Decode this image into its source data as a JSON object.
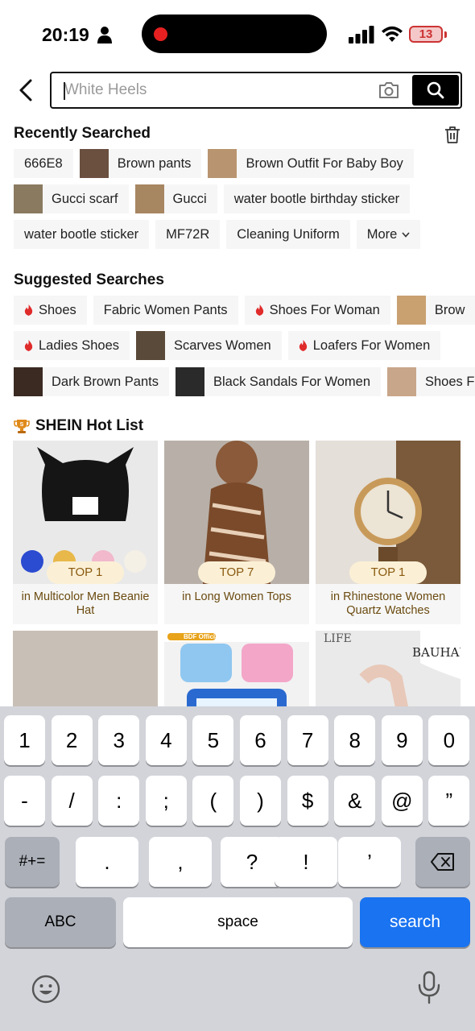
{
  "status_bar": {
    "time": "20:19",
    "battery": "13"
  },
  "search": {
    "placeholder": "White Heels"
  },
  "recent": {
    "title": "Recently Searched",
    "rows": [
      [
        {
          "label": "666E8",
          "thumb": false
        },
        {
          "label": "Brown pants",
          "thumb": true,
          "thumb_color": "#6b5040"
        },
        {
          "label": "Brown Outfit For Baby Boy",
          "thumb": true,
          "thumb_color": "#b89470"
        }
      ],
      [
        {
          "label": "Gucci scarf",
          "thumb": true,
          "thumb_color": "#8a7a60"
        },
        {
          "label": "Gucci",
          "thumb": true,
          "thumb_color": "#a78662"
        },
        {
          "label": "water bootle birthday sticker",
          "thumb": false
        }
      ],
      [
        {
          "label": "water bootle sticker",
          "thumb": false
        },
        {
          "label": "MF72R",
          "thumb": false
        },
        {
          "label": "Cleaning Uniform",
          "thumb": false
        },
        {
          "label": "More",
          "more": true
        }
      ]
    ]
  },
  "suggested": {
    "title": "Suggested Searches",
    "rows": [
      [
        {
          "label": "Shoes",
          "hot": true
        },
        {
          "label": "Fabric Women Pants"
        },
        {
          "label": "Shoes For Woman",
          "hot": true
        },
        {
          "label": "Brow",
          "thumb": true,
          "thumb_color": "#c9a070"
        }
      ],
      [
        {
          "label": "Ladies Shoes",
          "hot": true
        },
        {
          "label": "Scarves Women",
          "thumb": true,
          "thumb_color": "#5a4a3a"
        },
        {
          "label": "Loafers For Women",
          "hot": true
        }
      ],
      [
        {
          "label": "Dark Brown Pants",
          "thumb": true,
          "thumb_color": "#3a2a22"
        },
        {
          "label": "Black Sandals For Women",
          "thumb": true,
          "thumb_color": "#2a2a2a"
        },
        {
          "label": "Shoes F",
          "thumb": true,
          "thumb_color": "#c8a68a"
        }
      ]
    ]
  },
  "hot_list": {
    "title": "SHEIN Hot List",
    "cards": [
      {
        "badge": "TOP 1",
        "caption": "in Multicolor Men Beanie Hat",
        "bg": "#e9e9e9",
        "accent": "#151515"
      },
      {
        "badge": "TOP 7",
        "caption": "in Long Women Tops",
        "bg": "#b8b0a8",
        "accent": "#7a4a2a"
      },
      {
        "badge": "TOP 1",
        "caption": "in Rhinestone Women Quartz Watches",
        "bg": "#e4dfd8",
        "accent": "#6a4a2a"
      },
      {
        "bg": "#c8c0b6",
        "accent": "#7a3a1a"
      },
      {
        "bg": "#f2f2f2",
        "accent": "#2a6ad0",
        "store_label": "BDF Official Store"
      },
      {
        "bg": "#eaeaea",
        "accent": "#6a7a3a",
        "brand_text": "BAUHAU",
        "sign_text": "LIFE"
      }
    ]
  },
  "keyboard": {
    "row1": [
      "1",
      "2",
      "3",
      "4",
      "5",
      "6",
      "7",
      "8",
      "9",
      "0"
    ],
    "row2": [
      "-",
      "/",
      ":",
      ";",
      "(",
      ")",
      "$",
      "&",
      "@",
      "”"
    ],
    "row3": [
      ".",
      ",",
      "?",
      "!",
      "’"
    ],
    "mode_switch": "#+=",
    "abc": "ABC",
    "space": "space",
    "search": "search"
  },
  "colors": {
    "accent": "#1a73f0",
    "hot": "#e02b2b",
    "badge_text": "#8a5a10"
  }
}
